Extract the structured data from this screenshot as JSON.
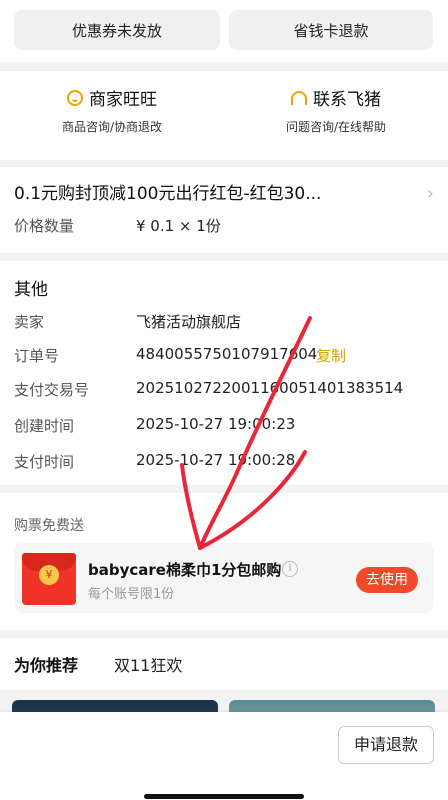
{
  "top_actions": {
    "coupon_unissued": "优惠券未发放",
    "savings_card_refund": "省钱卡退款"
  },
  "contact": {
    "shop": {
      "title": "商家旺旺",
      "subtitle": "商品咨询/协商退改"
    },
    "fliggy": {
      "title": "联系飞猪",
      "subtitle": "问题咨询/在线帮助"
    }
  },
  "product": {
    "title": "0.1元购封顶减100元出行红包-红包30...",
    "qty_label": "价格数量",
    "qty_value": "¥ 0.1 × 1份"
  },
  "other": {
    "title": "其他",
    "rows": [
      {
        "label": "卖家",
        "value": "飞猪活动旗舰店"
      },
      {
        "label": "订单号",
        "value": "4840055750107917604"
      },
      {
        "label": "支付交易号",
        "value": "2025102722001160051401383514"
      },
      {
        "label": "创建时间",
        "value": "2025-10-27 19:00:23"
      },
      {
        "label": "支付时间",
        "value": "2025-10-27 19:00:28"
      }
    ],
    "copy_label": "复制"
  },
  "gift": {
    "section_title": "购票免费送",
    "name": "babycare棉柔巾1分包邮购",
    "limit": "每个账号限1份",
    "use_button": "去使用",
    "coin_symbol": "¥",
    "info_symbol": "i"
  },
  "recommend": {
    "tabs": [
      "为你推荐",
      "双11狂欢"
    ]
  },
  "bottom_bar": {
    "apply_refund": "申请退款"
  },
  "colors": {
    "accent_gold": "#d4a000",
    "use_button": "#f04a2b",
    "annotation_red": "#e8283a"
  },
  "icons": {
    "shop_icon": "smile-icon",
    "fliggy_icon": "headset-icon",
    "chevron": "chevron-right-icon"
  }
}
